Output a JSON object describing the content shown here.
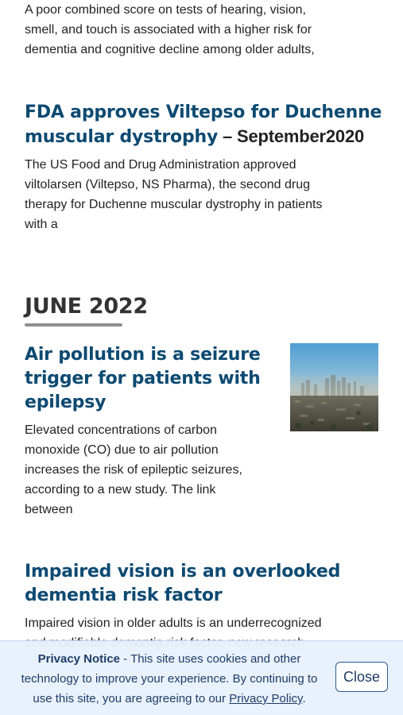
{
  "articles": {
    "senses": {
      "excerpt_lines": [
        "A poor combined score on tests of hearing, vision,",
        "smell, and touch is associated with a higher risk for",
        "dementia and cognitive decline among older adults,"
      ]
    },
    "viltepso": {
      "headline_lines": [
        "FDA approves Viltepso for Duchenne",
        "muscular dystrophy"
      ],
      "date": " – September2020",
      "excerpt_lines": [
        "The US Food and Drug Administration approved",
        "viltolarsen (Viltepso, NS Pharma), the second drug",
        "therapy for Duchenne muscular dystrophy in patients",
        "with a"
      ]
    },
    "air_pollution": {
      "headline_lines": [
        "Air pollution is a seizure",
        "trigger for patients with",
        "epilepsy"
      ],
      "excerpt_lines": [
        "Elevated concentrations of carbon",
        "monoxide (CO) due to air pollution",
        "increases the risk of epileptic seizures,",
        "according to a new study. The link",
        "between"
      ],
      "thumbnail_icon": "smog-city-skyline-image"
    },
    "impaired_vision": {
      "headline_lines": [
        "Impaired vision is an overlooked",
        "dementia risk factor"
      ],
      "excerpt_lines": [
        "Impaired vision in older adults is an underrecognized",
        "and modifiable dementia risk factor, new research"
      ]
    }
  },
  "month_section": {
    "heading": "JUNE 2022"
  },
  "privacy_banner": {
    "title": "Privacy Notice",
    "text_part1": " - This site uses cookies and other technology to improve your experience. By continuing to use this site, you are agreeing to our ",
    "link": "Privacy Policy",
    "text_end": ".",
    "close_label": "Close"
  },
  "colors": {
    "headline": "#0d4a72",
    "body_text": "#222222",
    "banner_bg": "#e8f0fc",
    "banner_text": "#1e3d66"
  }
}
